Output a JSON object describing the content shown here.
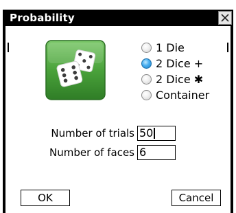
{
  "window": {
    "title": "Probability"
  },
  "mode_options": [
    {
      "label": "1 Die",
      "selected": false
    },
    {
      "label": "2 Dice +",
      "selected": true
    },
    {
      "label": "2 Dice ✱",
      "selected": false
    },
    {
      "label": "Container",
      "selected": false
    }
  ],
  "fields": {
    "trials_label": "Number of trials",
    "trials_value": "50",
    "faces_label": "Number of faces",
    "faces_value": "6"
  },
  "buttons": {
    "ok_label": "OK",
    "cancel_label": "Cancel"
  },
  "icons": {
    "tile": "dice-icon",
    "close": "close-icon"
  },
  "colors": {
    "tile_green": "#4aa23b",
    "selected_radio": "#3aa2ea"
  }
}
